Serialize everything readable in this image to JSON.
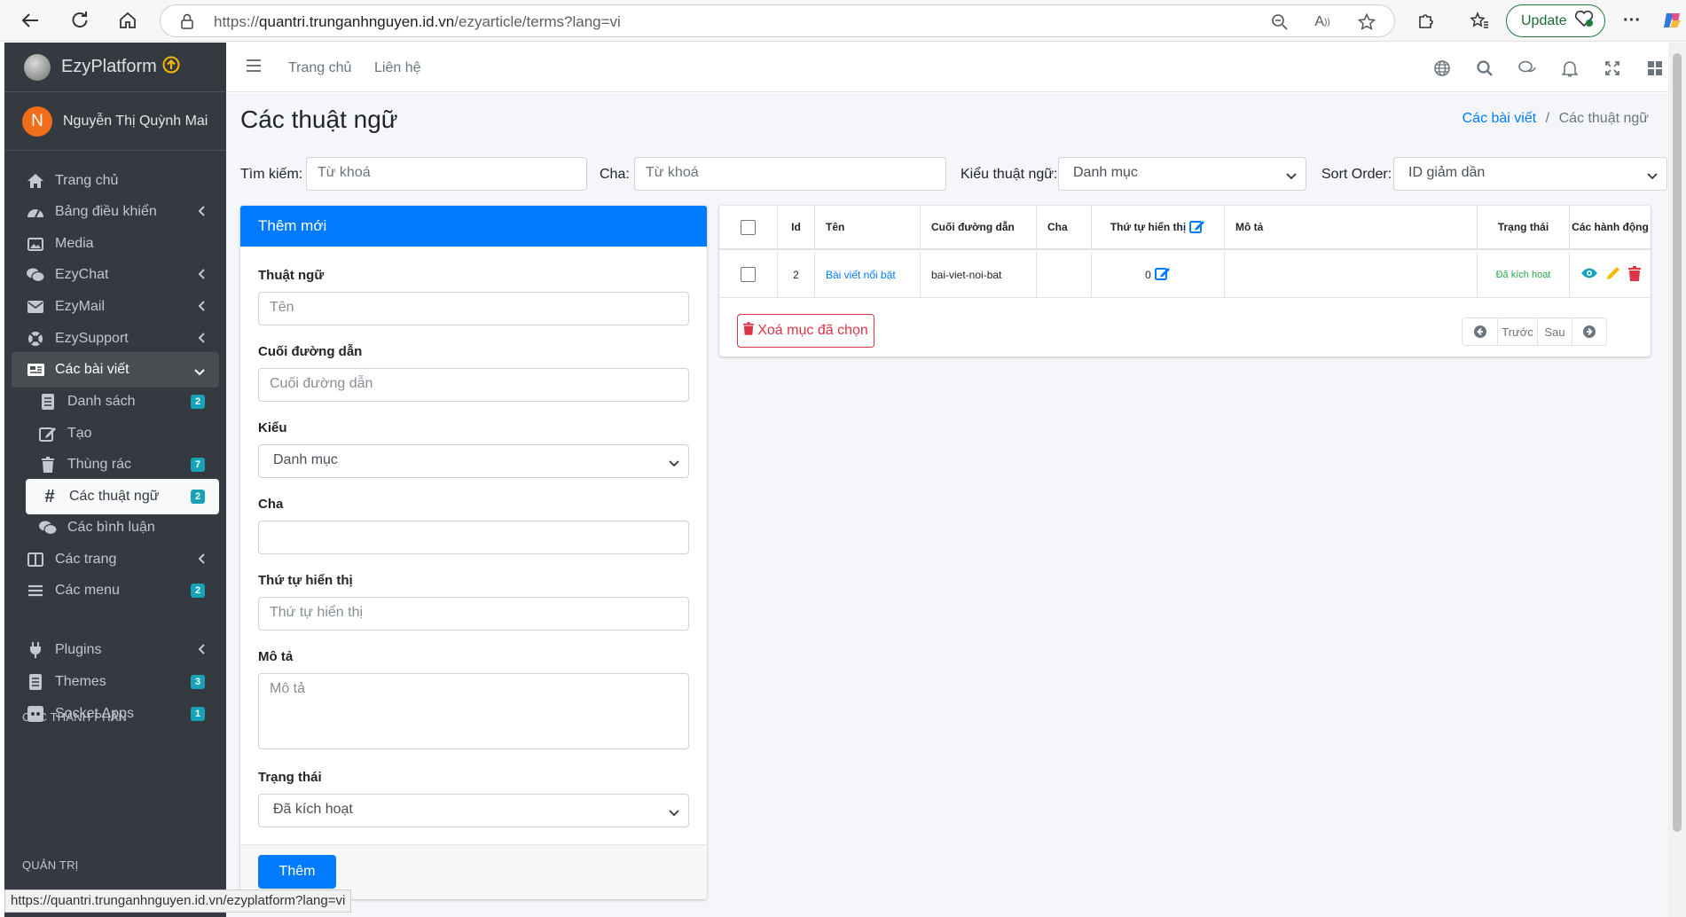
{
  "browser": {
    "url_prefix": "https://",
    "url_domain": "quantri.trunganhnguyen.id.vn",
    "url_path": "/ezyarticle/terms?lang=vi",
    "update_label": "Update"
  },
  "sidebar": {
    "brand": "EzyPlatform",
    "user_initial": "N",
    "user_name": "Nguyễn Thị Quỳnh Mai",
    "items": [
      {
        "label": "Trang chủ",
        "icon": "home-icon"
      },
      {
        "label": "Bảng điều khiển",
        "icon": "dashboard-icon"
      },
      {
        "label": "Media",
        "icon": "image-icon"
      },
      {
        "label": "EzyChat",
        "icon": "chat-icon"
      },
      {
        "label": "EzyMail",
        "icon": "mail-icon"
      },
      {
        "label": "EzySupport",
        "icon": "support-icon"
      },
      {
        "label": "Các bài viết",
        "icon": "newspaper-icon"
      },
      {
        "label": "Danh sách",
        "icon": "list-icon",
        "badge": "2"
      },
      {
        "label": "Tạo",
        "icon": "edit-icon"
      },
      {
        "label": "Thùng rác",
        "icon": "trash-icon",
        "badge": "7"
      },
      {
        "label": "Các thuật ngữ",
        "icon": "hashtag-icon",
        "badge": "2"
      },
      {
        "label": "Các bình luận",
        "icon": "comments-icon"
      },
      {
        "label": "Các trang",
        "icon": "columns-icon"
      },
      {
        "label": "Các menu",
        "icon": "bars-icon",
        "badge": "2"
      },
      {
        "label": "Plugins",
        "icon": "plug-icon"
      },
      {
        "label": "Themes",
        "icon": "theme-icon",
        "badge": "3"
      },
      {
        "label": "Socket Apps",
        "icon": "socket-icon",
        "badge": "1"
      }
    ],
    "section_components": "CÁC THÀNH PHẦN",
    "section_admin": "QUẢN TRỊ"
  },
  "topnav": {
    "home": "Trang chủ",
    "contact": "Liên hệ"
  },
  "page": {
    "title": "Các thuật ngữ",
    "breadcrumb_parent": "Các bài viết",
    "breadcrumb_sep": "/",
    "breadcrumb_current": "Các thuật ngữ"
  },
  "filters": {
    "search_label": "Tìm kiếm:",
    "search_placeholder": "Từ khoá",
    "parent_label": "Cha:",
    "parent_placeholder": "Từ khoá",
    "type_label": "Kiểu thuật ngữ:",
    "type_value": "Danh mục",
    "sort_label": "Sort Order:",
    "sort_value": "ID giảm dần"
  },
  "form": {
    "header": "Thêm mới",
    "term_label": "Thuật ngữ",
    "term_placeholder": "Tên",
    "slug_label": "Cuối đường dẫn",
    "slug_placeholder": "Cuối đường dẫn",
    "type_label": "Kiểu",
    "type_value": "Danh mục",
    "parent_label": "Cha",
    "order_label": "Thứ tự hiển thị",
    "order_placeholder": "Thứ tự hiển thị",
    "desc_label": "Mô tả",
    "desc_placeholder": "Mô tả",
    "status_label": "Trạng thái",
    "status_value": "Đã kích hoạt",
    "submit": "Thêm"
  },
  "table": {
    "columns": [
      "Id",
      "Tên",
      "Cuối đường dẫn",
      "Cha",
      "Thứ tự hiển thị",
      "Mô tả",
      "Trạng thái",
      "Các hành động"
    ],
    "rows": [
      {
        "id": "2",
        "name": "Bài viết nổi bật",
        "slug": "bai-viet-noi-bat",
        "parent": "",
        "order": "0",
        "description": "",
        "status": "Đã kích hoạt"
      }
    ],
    "delete_selected": "Xoá mục đã chọn",
    "prev": "Trước",
    "next": "Sau"
  },
  "statusbar_url": "https://quantri.trunganhnguyen.id.vn/ezyplatform?lang=vi",
  "colors": {
    "primary": "#007bff",
    "sidebar_bg": "#343a40",
    "danger": "#dc3545",
    "success": "#28a745",
    "badge": "#17a2b8"
  }
}
